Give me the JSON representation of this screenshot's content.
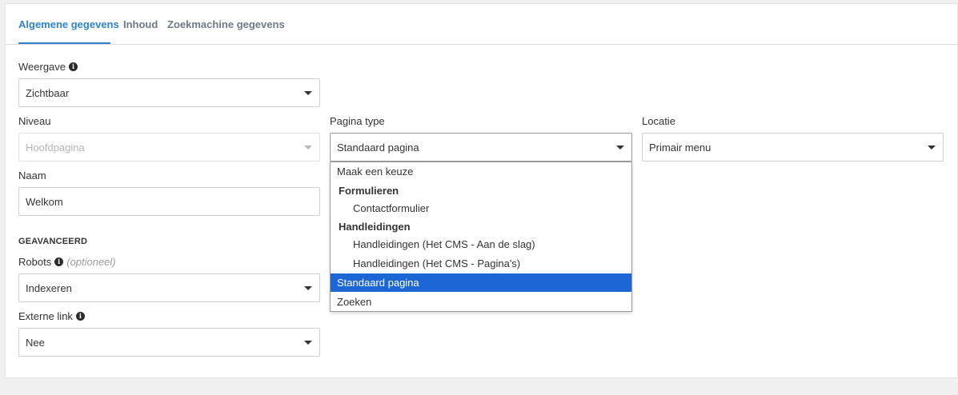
{
  "tabs": [
    {
      "label": "Algemene gegevens",
      "active": true
    },
    {
      "label": "Inhoud",
      "active": false
    },
    {
      "label": "Zoekmachine gegevens",
      "active": false
    }
  ],
  "weergave": {
    "label": "Weergave",
    "value": "Zichtbaar"
  },
  "niveau": {
    "label": "Niveau",
    "value": "Hoofdpagina"
  },
  "pagina_type": {
    "label": "Pagina type",
    "value": "Standaard pagina",
    "options": [
      {
        "label": "Maak een keuze"
      },
      {
        "group": "Formulieren"
      },
      {
        "label": "Contactformulier"
      },
      {
        "group": "Handleidingen"
      },
      {
        "label": "Handleidingen (Het CMS - Aan de slag)"
      },
      {
        "label": "Handleidingen (Het CMS - Pagina's)"
      },
      {
        "label": "Standaard pagina",
        "selected": true
      },
      {
        "label": "Zoeken"
      }
    ]
  },
  "locatie": {
    "label": "Locatie",
    "value": "Primair menu"
  },
  "naam": {
    "label": "Naam",
    "value": "Welkom"
  },
  "advanced": {
    "title": "GEAVANCEERD"
  },
  "robots": {
    "label": "Robots",
    "optional": "(optioneel)",
    "value": "Indexeren"
  },
  "externe_link": {
    "label": "Externe link",
    "value": "Nee"
  },
  "icons": {
    "info": "info-icon",
    "caret": "chevron-down-icon"
  },
  "colors": {
    "accent": "#2d83d1",
    "selected_option": "#1d66d6"
  }
}
